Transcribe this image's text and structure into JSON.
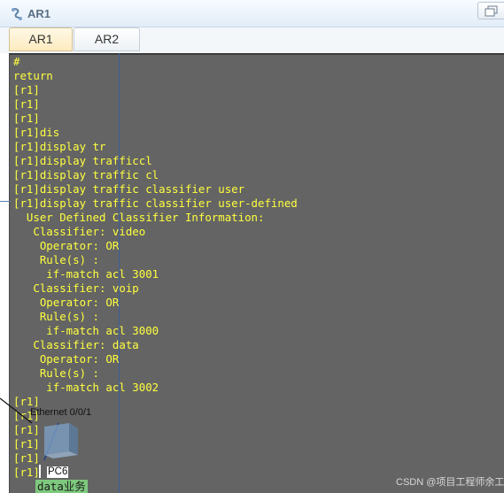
{
  "window": {
    "title": "AR1",
    "icon": "router-config-icon",
    "restore_icon": "restore-window-icon"
  },
  "tabs": [
    {
      "label": "AR1",
      "active": true
    },
    {
      "label": "AR2",
      "active": false
    }
  ],
  "console": {
    "text_color": "#ffff40",
    "background": "#646464",
    "lines": [
      "#",
      "return",
      "[r1]",
      "[r1]",
      "[r1]",
      "[r1]dis",
      "[r1]display tr",
      "[r1]display trafficcl",
      "[r1]display traffic cl",
      "[r1]display traffic classifier user",
      "[r1]display traffic classifier user-defined",
      "  User Defined Classifier Information:",
      "   Classifier: video",
      "    Operator: OR",
      "    Rule(s) :",
      "     if-match acl 3001",
      "   Classifier: voip",
      "    Operator: OR",
      "    Rule(s) :",
      "     if-match acl 3000",
      "   Classifier: data",
      "    Operator: OR",
      "    Rule(s) :",
      "     if-match acl 3002",
      "[r1]",
      "[r1]",
      "[r1]",
      "[r1]",
      "[r1]",
      "[r1]"
    ]
  },
  "topology": {
    "port_label": "Ethernet 0/0/1",
    "device_label": "PC6",
    "device_icon": "pc-icon",
    "device_description": "data业务"
  },
  "watermark": "CSDN @项目工程师余工"
}
